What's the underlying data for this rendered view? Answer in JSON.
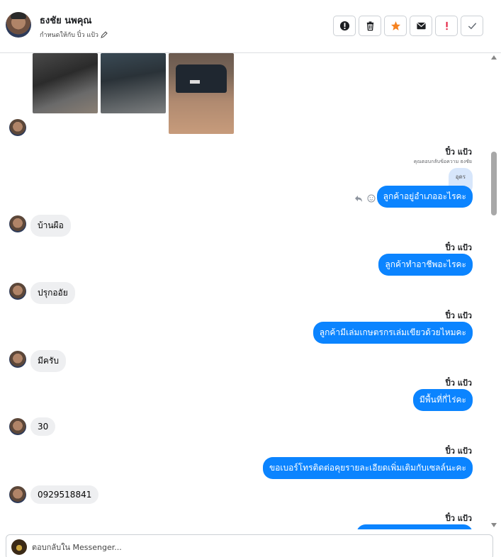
{
  "header": {
    "contact_name": "ธงชัย นพคุณ",
    "assigned_text": "กำหนดให้กับ ปิ๋ว แป้ว"
  },
  "actions": [
    {
      "name": "spam-button",
      "icon": "alert-circle-icon",
      "color": "#1c1e21"
    },
    {
      "name": "delete-button",
      "icon": "trash-icon",
      "color": "#1c1e21"
    },
    {
      "name": "star-button",
      "icon": "star-icon",
      "color": "#f5821f"
    },
    {
      "name": "mark-unread-button",
      "icon": "envelope-icon",
      "color": "#1c1e21"
    },
    {
      "name": "follow-up-button",
      "icon": "exclamation-icon",
      "color": "#e41e3f"
    },
    {
      "name": "done-button",
      "icon": "check-icon",
      "color": "#606770"
    }
  ],
  "colors": {
    "outgoing_bubble": "#0b84ff",
    "incoming_bubble": "#eeeff1",
    "quote_bubble": "#d7e6fb"
  },
  "messages": [
    {
      "sender": "ปิ๋ว แป้ว",
      "note": "คุณตอบกลับข้อความ ธงชัย",
      "quote": "อุดร",
      "text": "ลูกค้าอยู่อำเภออะไรคะ"
    },
    {
      "incoming": "บ้านผือ"
    },
    {
      "sender": "ปิ๋ว แป้ว",
      "text": "ลูกค้าทำอาชีพอะไรคะ"
    },
    {
      "incoming": "ปรุกออัย"
    },
    {
      "sender": "ปิ๋ว แป้ว",
      "text": "ลูกค้ามีเล่มเกษตรกรเล่มเขียวด้วยไหมคะ"
    },
    {
      "incoming": "มีครับ"
    },
    {
      "sender": "ปิ๋ว แป้ว",
      "text": "มีพื้นที่กี่ไร่คะ"
    },
    {
      "incoming": "30"
    },
    {
      "sender": "ปิ๋ว แป้ว",
      "text": "ขอเบอร์โทรติดต่อคุยรายละเอียดเพิ่มเติมกับเซลล์นะคะ"
    },
    {
      "incoming": "0929518841"
    },
    {
      "sender": "ปิ๋ว แป้ว"
    }
  ],
  "composer": {
    "placeholder": "ตอบกลับใน Messenger..."
  }
}
